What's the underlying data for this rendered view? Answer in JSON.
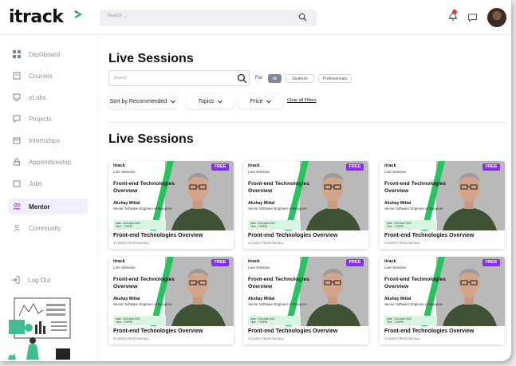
{
  "header": {
    "logo_text": "itrack",
    "search_placeholder": "Search ..."
  },
  "sidebar": {
    "items": [
      {
        "label": "Dashboard",
        "icon": "grid-icon"
      },
      {
        "label": "Courses",
        "icon": "book-icon"
      },
      {
        "label": "eLabs",
        "icon": "monitor-icon"
      },
      {
        "label": "Projects",
        "icon": "chat-icon"
      },
      {
        "label": "Internships",
        "icon": "calendar-icon"
      },
      {
        "label": "Apprenticeship",
        "icon": "puzzle-icon"
      },
      {
        "label": "Jobs",
        "icon": "briefcase-icon"
      },
      {
        "label": "Mentor",
        "icon": "users-icon",
        "active": true
      },
      {
        "label": "Community",
        "icon": "people-icon"
      }
    ],
    "logout_label": "Log Out"
  },
  "filters": {
    "page_title": "Live Sessions",
    "search_placeholder": "Search",
    "for_label": "For",
    "audience": [
      "All",
      "Students",
      "Professionals"
    ],
    "sort_label": "Sort by Recommended",
    "topics_label": "Topics",
    "price_label": "Price",
    "clear_label": "Clear all Filters"
  },
  "section_title": "Live Sessions",
  "cards": [
    {
      "brand": "itrack",
      "session_type": "Live Session",
      "banner_title": "Front-end Technologies Overview",
      "speaker": "Akshay Mittal",
      "role": "Senior Software Engineer at Banglore",
      "date_line": "Date : 23rd April 2022",
      "time_line": "Time : 7:00PM",
      "badge": "FREE",
      "title": "Front-end Technologies Overview",
      "tag": "STUDENT PROFESSIONAL"
    },
    {
      "brand": "itrack",
      "session_type": "Live Session",
      "banner_title": "Front-end Technologies Overview",
      "speaker": "Akshay Mittal",
      "role": "Senior Software Engineer at Banglore",
      "date_line": "Date : 23rd April 2022",
      "time_line": "Time : 7:00PM",
      "badge": "FREE",
      "title": "Front-end Technologies Overview",
      "tag": "STUDENT PROFESSIONAL"
    },
    {
      "brand": "itrack",
      "session_type": "Live Session",
      "banner_title": "Front-end Technologies Overview",
      "speaker": "Akshay Mittal",
      "role": "Senior Software Engineer at Banglore",
      "date_line": "Date : 23rd April 2022",
      "time_line": "Time : 7:00PM",
      "badge": "FREE",
      "title": "Front-end Technologies Overview",
      "tag": "STUDENT PROFESSIONAL"
    },
    {
      "brand": "itrack",
      "session_type": "Live Session",
      "banner_title": "Front-end Technologies Overview",
      "speaker": "Akshay Mittal",
      "role": "Senior Software Engineer at Banglore",
      "date_line": "Date : 23rd April 2022",
      "time_line": "Time : 7:00PM",
      "badge": "FREE",
      "title": "Front-end Technologies Overview",
      "tag": "STUDENT PROFESSIONAL"
    },
    {
      "brand": "itrack",
      "session_type": "Live Session",
      "banner_title": "Front-end Technologies Overview",
      "speaker": "Akshay Mittal",
      "role": "Senior Software Engineer at Banglore",
      "date_line": "Date : 23rd April 2022",
      "time_line": "Time : 7:00PM",
      "badge": "FREE",
      "title": "Front-end Technologies Overview",
      "tag": "STUDENT PROFESSIONAL"
    },
    {
      "brand": "itrack",
      "session_type": "Live Session",
      "banner_title": "Front-end Technologies Overview",
      "speaker": "Akshay Mittal",
      "role": "Senior Software Engineer at Banglore",
      "date_line": "Date : 23rd April 2022",
      "time_line": "Time : 7:00PM",
      "badge": "FREE",
      "title": "Front-end Technologies Overview",
      "tag": "STUDENT PROFESSIONAL"
    }
  ],
  "colors": {
    "accent_green": "#22c55e",
    "badge_purple": "#8b2cf5",
    "active_nav_bg": "#f3eefd",
    "alert_red": "#e53935"
  }
}
